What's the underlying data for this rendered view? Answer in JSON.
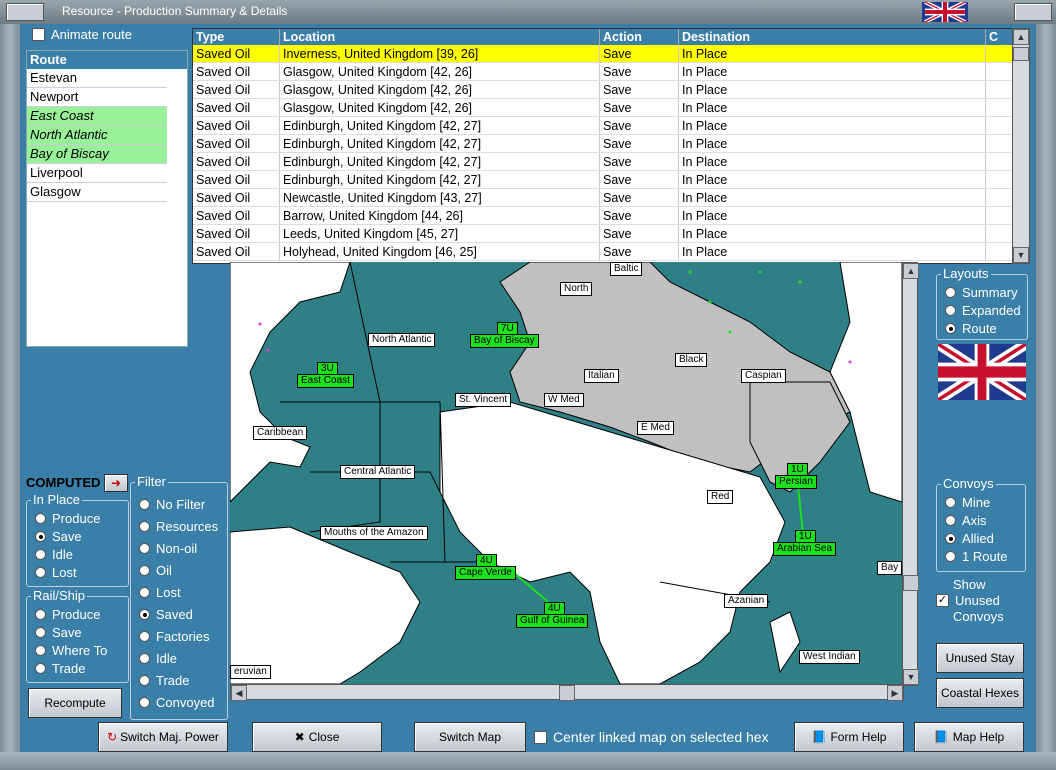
{
  "window": {
    "title": "Resource - Production Summary & Details"
  },
  "animate_route": {
    "label": "Animate route",
    "checked": false
  },
  "route_list": {
    "header": "Route",
    "items": [
      {
        "label": "Estevan",
        "highlighted": false
      },
      {
        "label": "Newport",
        "highlighted": false
      },
      {
        "label": "East Coast",
        "highlighted": true
      },
      {
        "label": "North Atlantic",
        "highlighted": true
      },
      {
        "label": "Bay of Biscay",
        "highlighted": true
      },
      {
        "label": "Liverpool",
        "highlighted": false
      },
      {
        "label": "Glasgow",
        "highlighted": false
      }
    ]
  },
  "table": {
    "columns": [
      "Type",
      "Location",
      "Action",
      "Destination",
      "C"
    ],
    "rows": [
      [
        "Saved Oil",
        "Inverness, United Kingdom [39, 26]",
        "Save",
        "In Place"
      ],
      [
        "Saved Oil",
        "Glasgow, United Kingdom [42, 26]",
        "Save",
        "In Place"
      ],
      [
        "Saved Oil",
        "Glasgow, United Kingdom [42, 26]",
        "Save",
        "In Place"
      ],
      [
        "Saved Oil",
        "Glasgow, United Kingdom [42, 26]",
        "Save",
        "In Place"
      ],
      [
        "Saved Oil",
        "Edinburgh, United Kingdom [42, 27]",
        "Save",
        "In Place"
      ],
      [
        "Saved Oil",
        "Edinburgh, United Kingdom [42, 27]",
        "Save",
        "In Place"
      ],
      [
        "Saved Oil",
        "Edinburgh, United Kingdom [42, 27]",
        "Save",
        "In Place"
      ],
      [
        "Saved Oil",
        "Edinburgh, United Kingdom [42, 27]",
        "Save",
        "In Place"
      ],
      [
        "Saved Oil",
        "Newcastle, United Kingdom [43, 27]",
        "Save",
        "In Place"
      ],
      [
        "Saved Oil",
        "Barrow, United Kingdom [44, 26]",
        "Save",
        "In Place"
      ],
      [
        "Saved Oil",
        "Leeds, United Kingdom [45, 27]",
        "Save",
        "In Place"
      ],
      [
        "Saved Oil",
        "Holyhead, United Kingdom [46, 25]",
        "Save",
        "In Place"
      ]
    ],
    "selected_row": 0
  },
  "map": {
    "labels": [
      "Baltic",
      "North",
      "North Atlantic",
      "Black",
      "Caspian",
      "Italian",
      "St. Vincent",
      "W Med",
      "E Med",
      "Caribbean",
      "Central Atlantic",
      "Red",
      "Mouths of the Amazon",
      "Azanian",
      "West Indian",
      "Bay",
      "eruvian"
    ],
    "convoy_labels": [
      {
        "count": "7U",
        "name": "Bay of Biscay"
      },
      {
        "count": "3U",
        "name": "East Coast"
      },
      {
        "count": "1U",
        "name": "Persian"
      },
      {
        "count": "1U",
        "name": "Arabian Sea"
      },
      {
        "count": "4U",
        "name": "Cape Verde"
      },
      {
        "count": "4U",
        "name": "Gulf of Guinea"
      }
    ]
  },
  "computed": {
    "label": "COMPUTED"
  },
  "in_place": {
    "title": "In Place",
    "options": [
      "Produce",
      "Save",
      "Idle",
      "Lost"
    ],
    "selected": 1
  },
  "rail_ship": {
    "title": "Rail/Ship",
    "options": [
      "Produce",
      "Save",
      "Where To",
      "Trade"
    ],
    "selected": -1
  },
  "filter": {
    "title": "Filter",
    "options": [
      "No Filter",
      "Resources",
      "Non-oil",
      "Oil",
      "Lost",
      "Saved",
      "Factories",
      "Idle",
      "Trade",
      "Convoyed"
    ],
    "selected": 5
  },
  "layouts": {
    "title": "Layouts",
    "options": [
      "Summary",
      "Expanded",
      "Route"
    ],
    "selected": 2
  },
  "convoys": {
    "title": "Convoys",
    "options": [
      "Mine",
      "Axis",
      "Allied",
      "1 Route"
    ],
    "selected": 2
  },
  "show_unused": {
    "label_1": "Show",
    "label_2": "Unused",
    "label_3": "Convoys",
    "checked": true
  },
  "buttons": {
    "recompute": "Recompute",
    "switch_power": "Switch Maj. Power",
    "close": "Close",
    "switch_map": "Switch Map",
    "form_help": "Form Help",
    "map_help": "Map Help",
    "unused_stay": "Unused Stay",
    "coastal_hexes": "Coastal Hexes"
  },
  "center_linked": {
    "label": "Center linked map on selected hex",
    "checked": false
  },
  "colors": {
    "frame": "#3a7fa8",
    "selected_row": "#ffff00",
    "route_highlight": "#98f098",
    "convoy_label": "#1de01d",
    "sea": "#2e7f86"
  }
}
